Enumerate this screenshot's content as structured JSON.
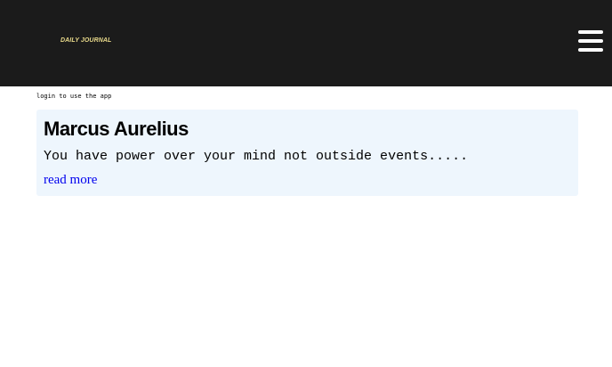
{
  "header": {
    "logo_text": "DAILY JOURNAL",
    "menu_icon": "hamburger-menu-icon"
  },
  "main": {
    "login_note": "login to use the app",
    "posts": [
      {
        "title": "Marcus Aurelius",
        "excerpt": "You have power over your mind not outside events.....",
        "link_label": "read more"
      }
    ]
  },
  "colors": {
    "header_bg": "#1b1b1b",
    "logo": "#e8d98a",
    "card_bg": "#eef6fd",
    "link": "#0000ee"
  }
}
